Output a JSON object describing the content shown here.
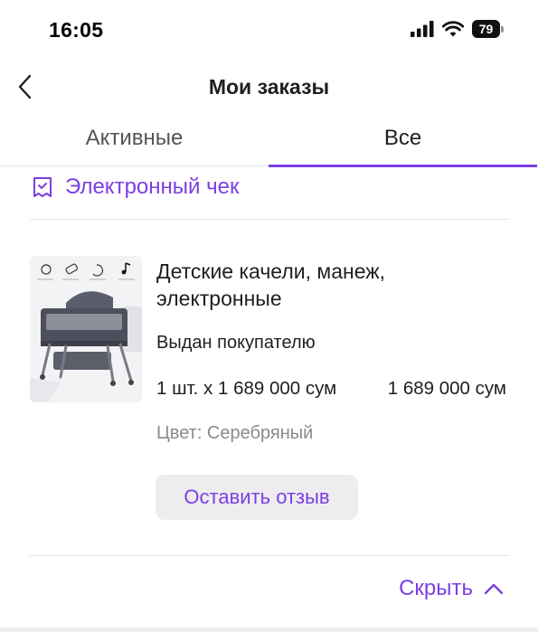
{
  "status_bar": {
    "time": "16:05",
    "battery": "79"
  },
  "header": {
    "title": "Мои заказы"
  },
  "tabs": [
    {
      "label": "Активные",
      "active": false
    },
    {
      "label": "Все",
      "active": true
    }
  ],
  "receipt": {
    "label": "Электронный чек",
    "icon": "receipt-icon"
  },
  "order": {
    "product": {
      "title": "Детские качели, манеж, электронные",
      "status": "Выдан покупателю",
      "quantity_price": "1 шт. x 1 689 000 сум",
      "total": "1 689 000 сум",
      "color": "Цвет: Серебряный",
      "image_icon": "baby-crib-image"
    },
    "review_button": "Оставить отзыв"
  },
  "hide": {
    "label": "Скрыть",
    "icon": "chevron-up-icon"
  },
  "colors": {
    "accent": "#7b3fe4",
    "muted": "#8a8a90",
    "button_bg": "#ededf0"
  }
}
